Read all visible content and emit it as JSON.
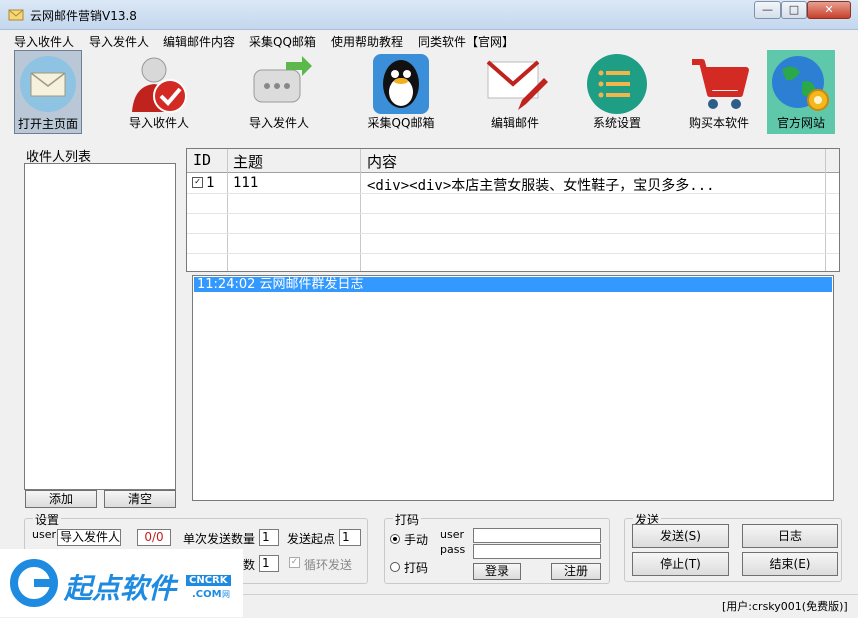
{
  "window": {
    "title": "云网邮件营销V13.8",
    "min": "—",
    "max": "□",
    "close": "✕"
  },
  "menu": [
    "导入收件人",
    "导入发件人",
    "编辑邮件内容",
    "采集QQ邮箱",
    "使用帮助教程",
    "同类软件【官网】"
  ],
  "toolbar": [
    {
      "label": "打开主页面",
      "icon": "envelope-icon"
    },
    {
      "label": "导入收件人",
      "icon": "user-check-icon"
    },
    {
      "label": "导入发件人",
      "icon": "message-arrow-icon"
    },
    {
      "label": "采集QQ邮箱",
      "icon": "qq-penguin-icon"
    },
    {
      "label": "编辑邮件",
      "icon": "mail-edit-icon"
    },
    {
      "label": "系统设置",
      "icon": "settings-list-icon"
    },
    {
      "label": "购买本软件",
      "icon": "cart-icon"
    },
    {
      "label": "官方网站",
      "icon": "globe-icon"
    }
  ],
  "recipients": {
    "caption": "收件人列表",
    "add": "添加",
    "clear": "清空"
  },
  "grid": {
    "columns": [
      "ID",
      "主题",
      "内容"
    ],
    "rows": [
      {
        "id": "1",
        "subject": "111",
        "content": "<div><div>本店主营女服装、女性鞋子，宝贝多多..."
      }
    ]
  },
  "log": {
    "entry": "11:24:02 云网邮件群发日志"
  },
  "settings": {
    "caption": "设置",
    "user_label": "user",
    "sender_value": "导入发件人",
    "count": "0/0",
    "per_send_label": "单次发送数量",
    "per_send_value": "1",
    "start_label": "发送起点",
    "start_value": "1",
    "partial_label": "数",
    "partial_value": "1",
    "loop_label": "循环发送"
  },
  "captcha": {
    "caption": "打码",
    "manual": "手动",
    "auto": "打码",
    "user_label": "user",
    "pass_label": "pass",
    "login": "登录",
    "register": "注册"
  },
  "send": {
    "caption": "发送",
    "send": "发送(S)",
    "log": "日志",
    "stop": "停止(T)",
    "end": "结束(E)"
  },
  "status": {
    "user": "[用户:crsky001(免费版)]"
  },
  "watermark": {
    "text": "起点软件",
    "badge": "CNCRK",
    "domain": ".COM",
    "suffix": "网"
  },
  "colors": {
    "accent": "#3399ff",
    "selected_bg": "#b9c7d6",
    "official_bg": "#60c8aa",
    "watermark_blue": "#1e8be0",
    "watermark_orange": "#f0a020"
  }
}
